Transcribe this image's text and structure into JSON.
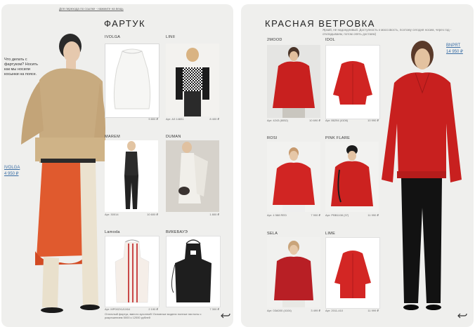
{
  "top_link": "Для перехода по ссылке - нажмите на вещь",
  "left_page": {
    "title": "ФАРТУК",
    "side_question": "Что делать с фартуком? Носить как мы носили косынки на поясе.",
    "model_brand": "IVOLGA",
    "model_price": "4 950 ₽",
    "products": [
      {
        "brand": "IVOLGA",
        "article": "",
        "price": "9 800 ₽"
      },
      {
        "brand": "LINII",
        "article": "Арт. A3 14831",
        "price": "8 400 ₽"
      },
      {
        "brand": "MAREM",
        "article": "Арт. 30014",
        "price": "10 600 ₽"
      },
      {
        "brand": "DUMAN",
        "article": "",
        "price": "1 800 ₽"
      },
      {
        "brand": "Lamoda",
        "article": "Арт. MP002XU1X64",
        "price": "2 190 ₽"
      },
      {
        "brand": "ВИКЕБАУЭ",
        "article": "",
        "price": "7 300 ₽"
      }
    ],
    "footnote": "Отличный фартук, вместо кухонной! Основные модели полные пистолы с разрешением 5000 к 12000 рублей"
  },
  "right_page": {
    "title": "КРАСНАЯ ВЕТРОВКА",
    "subtitle": "Яркий, не надоедливый. Доступность к массовость, поэтому сегодня носим, через год - откладываем, потом опять достаем)",
    "model_brand": "BNPRT",
    "model_price": "14 950 ₽",
    "products": [
      {
        "brand": "2MOOD",
        "article": "Арт. 4243 (8052)",
        "price": "10 690 ₽"
      },
      {
        "brand": "IDOL",
        "article": "Арт. 86294 (4106)",
        "price": "10 990 ₽"
      },
      {
        "brand": "ROSI",
        "article": "Арт. 4 588 RED",
        "price": "7 900 ₽"
      },
      {
        "brand": "PINK FLARE",
        "article": "Арт. PBB1108 (37)",
        "price": "11 990 ₽"
      },
      {
        "brand": "SELA",
        "article": "Арт. 03A000 (4104)",
        "price": "3 499 ₽"
      },
      {
        "brand": "LIME",
        "article": "Арт. 2011-410",
        "price": "11 999 ₽"
      }
    ]
  },
  "colors": {
    "page_bg": "#efefed",
    "link": "#3a6ea5",
    "red": "#c8201f"
  }
}
